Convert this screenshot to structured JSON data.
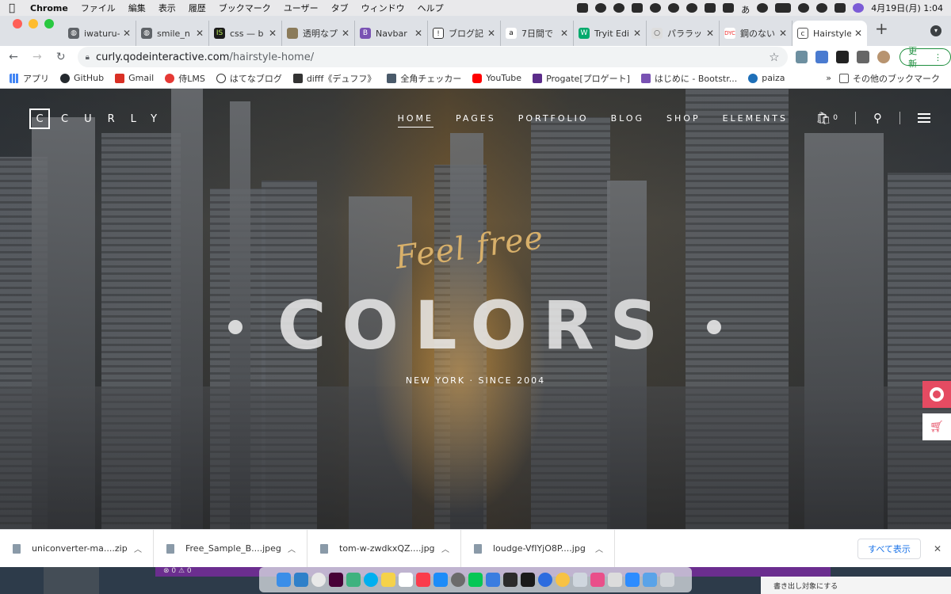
{
  "menubar": {
    "app": "Chrome",
    "items": [
      "ファイル",
      "編集",
      "表示",
      "履歴",
      "ブックマーク",
      "ユーザー",
      "タブ",
      "ウィンドウ",
      "ヘルプ"
    ],
    "clock": "4月19日(月) 1:04",
    "ime_indicator": "あ"
  },
  "tabs": [
    {
      "label": "iwaturu-",
      "icon": "globe"
    },
    {
      "label": "smile_n",
      "icon": "globe"
    },
    {
      "label": "css — b",
      "icon": "IS"
    },
    {
      "label": "透明なプ",
      "icon": "image"
    },
    {
      "label": "Navbar",
      "icon": "B"
    },
    {
      "label": "ブログ記",
      "icon": "circle"
    },
    {
      "label": "7日間で",
      "icon": "a"
    },
    {
      "label": "Tryit Edi",
      "icon": "W"
    },
    {
      "label": "パララッ",
      "icon": "circle"
    },
    {
      "label": "鋼のない",
      "icon": "DYC"
    },
    {
      "label": "Hairstyle",
      "icon": "c"
    }
  ],
  "toolbar": {
    "url_host": "curly.qodeinteractive.com",
    "url_path": "/hairstyle-home/",
    "update_label": "更新"
  },
  "bookmarks": [
    {
      "label": "アプリ",
      "color": "#4285f4"
    },
    {
      "label": "GitHub",
      "color": "#24292e"
    },
    {
      "label": "Gmail",
      "color": "#d93025"
    },
    {
      "label": "侍LMS",
      "color": "#e53935"
    },
    {
      "label": "はてなブログ",
      "color": "#333333"
    },
    {
      "label": "difff《デュフフ》",
      "color": "#333333"
    },
    {
      "label": "全角チェッカー",
      "color": "#4a5a6a"
    },
    {
      "label": "YouTube",
      "color": "#ff0000"
    },
    {
      "label": "Progate[プロゲート]",
      "color": "#5b2c8a"
    },
    {
      "label": "はじめに - Bootstr...",
      "color": "#7952b3"
    },
    {
      "label": "paiza",
      "color": "#1e6fb8"
    }
  ],
  "bookmarks_more": "»",
  "bookmarks_other": "その他のブックマーク",
  "site": {
    "logo": "CURLY",
    "nav": [
      "HOME",
      "PAGES",
      "PORTFOLIO",
      "BLOG",
      "SHOP",
      "ELEMENTS"
    ],
    "cart_count": "0",
    "script_text": "Feel free",
    "headline": "COLORS",
    "tagline": "NEW YORK · SINCE 2004",
    "accent": "#e54b62"
  },
  "downloads": [
    {
      "name": "uniconverter-ma....zip"
    },
    {
      "name": "Free_Sample_B....jpeg"
    },
    {
      "name": "tom-w-zwdkxQZ....jpg"
    },
    {
      "name": "loudge-VfIYjO8P....jpg"
    }
  ],
  "downloads_show_all": "すべて表示",
  "bottom": {
    "status_text": "⊗ 0 ⚠ 0",
    "right_text": "書き出し対象にする"
  }
}
